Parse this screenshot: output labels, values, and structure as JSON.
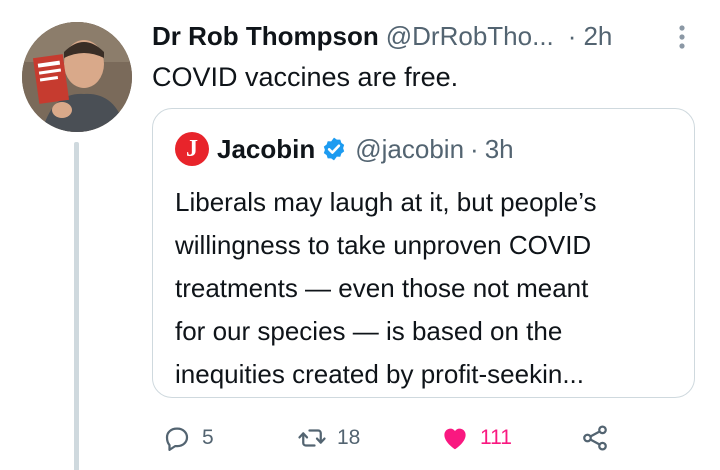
{
  "tweet": {
    "author_name": "Dr Rob Thompson",
    "author_handle": "@DrRobTho...",
    "separator": "·",
    "time": "2h",
    "text": "COVID vaccines are free.",
    "avatar_icon": "profile-photo"
  },
  "quote": {
    "logo_letter": "J",
    "logo_color": "#e8242b",
    "name": "Jacobin",
    "verified_icon": "verified-badge-icon",
    "handle": "@jacobin",
    "separator": "·",
    "time": "3h",
    "lines": [
      "Liberals may laugh at it, but people’s",
      "willingness to take unproven COVID",
      "treatments — even those not meant",
      "for our species — is based on the",
      "inequities created by profit-seekin..."
    ]
  },
  "actions": {
    "reply_count": "5",
    "retweet_count": "18",
    "like_count": "111",
    "like_color": "#f91880"
  }
}
